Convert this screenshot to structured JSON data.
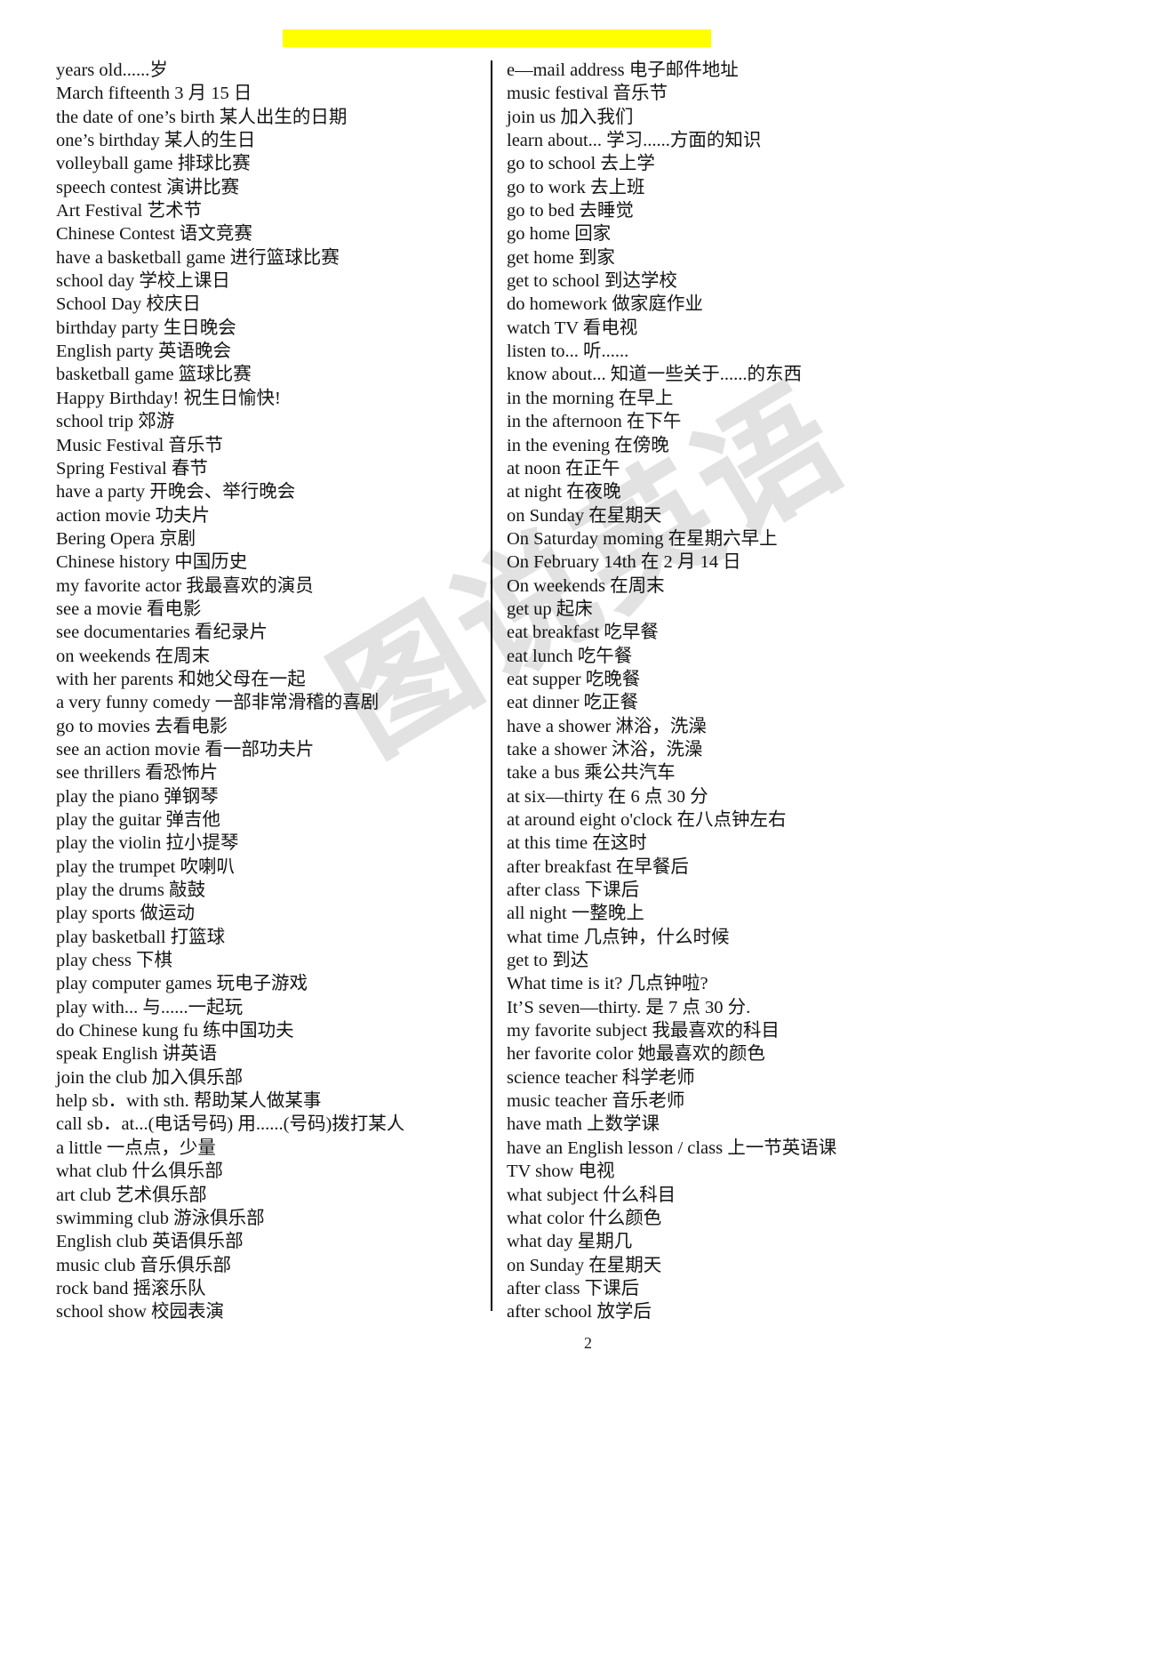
{
  "document": {
    "page_number": "2",
    "watermark_text": "图说英语"
  },
  "highlight_bar": {
    "color": "#ffff00",
    "text": ""
  },
  "columns": {
    "left": [
      "years old......岁",
      "March fifteenth 3 月 15 日",
      "the date of one’s birth 某人出生的日期",
      "one’s birthday 某人的生日",
      "volleyball game 排球比赛",
      "speech contest 演讲比赛",
      "Art Festival 艺术节",
      "Chinese Contest 语文竞赛",
      "have a basketball game 进行篮球比赛",
      "school day 学校上课日",
      "School Day 校庆日",
      "birthday party  生日晚会",
      "English party 英语晚会",
      "basketball game 篮球比赛",
      "Happy Birthday!   祝生日愉快!",
      "school trip 郊游",
      "Music Festival 音乐节",
      "Spring Festival  春节",
      "have a party 开晚会、举行晚会",
      "action movie 功夫片",
      "Bering Opera 京剧",
      "Chinese history   中国历史",
      "my favorite actor 我最喜欢的演员",
      "see a movie 看电影",
      "see documentaries 看纪录片",
      "on weekends 在周末",
      "with her parents 和她父母在一起",
      "a very funny comedy 一部非常滑稽的喜剧",
      "go to movies 去看电影",
      "see an action movie 看一部功夫片",
      "see thrillers 看恐怖片",
      "play the piano 弹钢琴",
      "play the guitar 弹吉他",
      "play the violin 拉小提琴",
      "play the trumpet 吹喇叭",
      "play the drums 敲鼓",
      "play sports 做运动",
      "play basketball 打篮球",
      "play chess 下棋",
      "play computer games 玩电子游戏",
      "play with...   与......一起玩",
      "do Chinese kung fu 练中国功夫",
      "speak English 讲英语",
      "join the club 加入俱乐部",
      "help sb．with sth.     帮助某人做某事",
      "call sb．at...(电话号码)   用......(号码)拨打某人",
      "a little 一点点，少量",
      "what club 什么俱乐部",
      "art club 艺术俱乐部",
      "swimming club 游泳俱乐部",
      "English club 英语俱乐部",
      "music club 音乐俱乐部",
      "rock band 摇滚乐队",
      "school show 校园表演"
    ],
    "right": [
      "e—mail address 电子邮件地址",
      "music festival 音乐节",
      "join us  加入我们",
      "learn about...   学习......方面的知识",
      "go to school 去上学",
      "go to work 去上班",
      "go to bed 去睡觉",
      "go home 回家",
      "get home 到家",
      "get to school 到达学校",
      "do homework 做家庭作业",
      "watch TV 看电视",
      "listen to...   听......",
      "know about...   知道一些关于......的东西",
      "in the morning 在早上",
      "in the afternoon 在下午",
      "in the evening 在傍晚",
      "at noon 在正午",
      "at night 在夜晚",
      "on Sunday 在星期天",
      "On Saturday moming 在星期六早上",
      "On February 14th 在 2 月 14 日",
      "On weekends 在周末",
      "get up 起床",
      "eat breakfast 吃早餐",
      "eat lunch 吃午餐",
      "eat supper 吃晚餐",
      "eat dinner 吃正餐",
      "have a shower 淋浴，洗澡",
      "take a shower 沐浴，洗澡",
      "take a bus 乘公共汽车",
      "at six—thirty 在 6 点 30 分",
      "at around eight o'clock 在八点钟左右",
      "at this time 在这时",
      "after breakfast 在早餐后",
      "after class 下课后",
      "all night 一整晚上",
      "what time 几点钟，什么时候",
      "get to 到达",
      "What time is it?   几点钟啦?",
      "It’S seven—thirty.     是 7 点 30 分.",
      "my favorite subject 我最喜欢的科目",
      "her favorite color 她最喜欢的颜色",
      "science teacher 科学老师",
      "music teacher 音乐老师",
      "have math 上数学课",
      "have an English lesson / class 上一节英语课",
      "TV show 电视",
      "what subject 什么科目",
      "what color 什么颜色",
      "what day 星期几",
      "on Sunday 在星期天",
      "after class 下课后",
      "after school 放学后"
    ]
  }
}
